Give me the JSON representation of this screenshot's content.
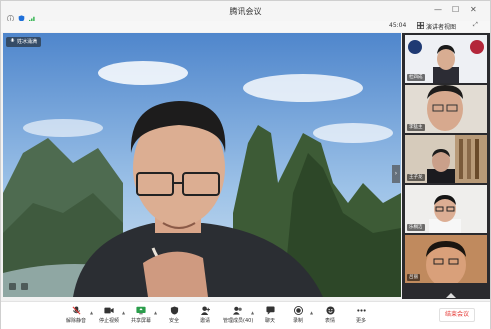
{
  "window": {
    "title": "腾讯会议"
  },
  "infobar": {
    "timer": "45:04",
    "view_label": "演讲者视图"
  },
  "main": {
    "speaker_label": "姓冰涌满"
  },
  "participants": [
    {
      "name": "杜四成"
    },
    {
      "name": "李猛主"
    },
    {
      "name": "王子龙"
    },
    {
      "name": "乐桐洁"
    },
    {
      "name": "吕丽"
    }
  ],
  "toolbar": {
    "items": [
      {
        "label": "解除静音",
        "icon": "mic-off-icon"
      },
      {
        "label": "停止视频",
        "icon": "camera-icon"
      },
      {
        "label": "共享屏幕",
        "icon": "share-screen-icon"
      },
      {
        "label": "安全",
        "icon": "shield-icon"
      },
      {
        "label": "邀请",
        "icon": "invite-icon"
      },
      {
        "label": "管理成员(40)",
        "icon": "members-icon"
      },
      {
        "label": "聊天",
        "icon": "chat-icon"
      },
      {
        "label": "录制",
        "icon": "record-icon"
      },
      {
        "label": "表情",
        "icon": "emoji-icon"
      },
      {
        "label": "更多",
        "icon": "more-icon"
      }
    ],
    "end_label": "结束会议"
  },
  "colors": {
    "end_red": "#e53935",
    "accent_blue": "#1e6fd9",
    "sidebar_bg": "#2a2a2e"
  }
}
